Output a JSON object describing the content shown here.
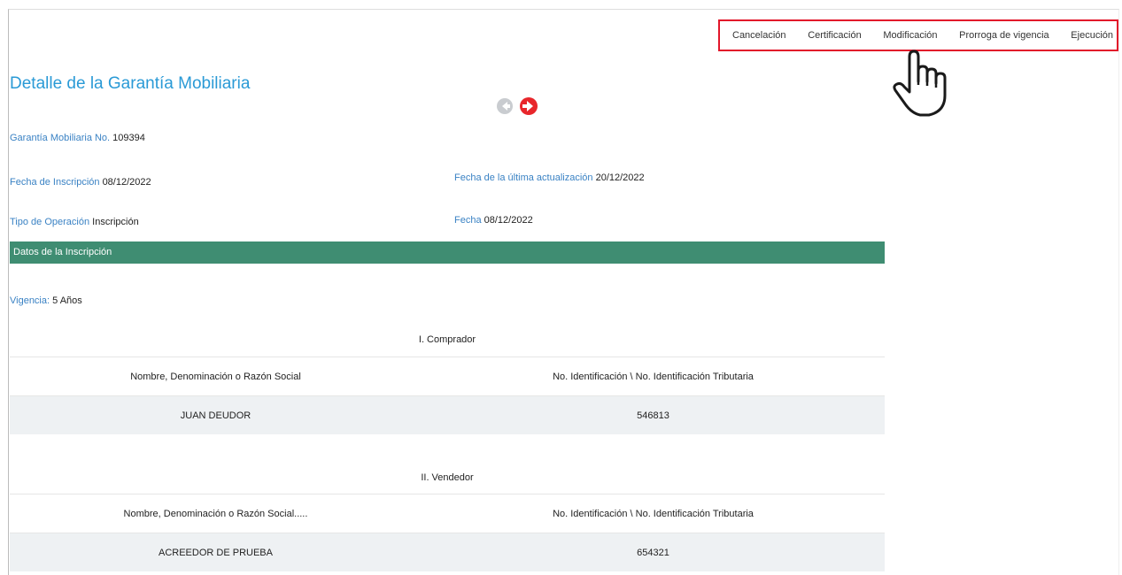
{
  "nav": {
    "items": [
      "Cancelación",
      "Certificación",
      "Modificación",
      "Prorroga de vigencia",
      "Ejecución"
    ]
  },
  "page": {
    "title": "Detalle de la Garantía Mobiliaria"
  },
  "details": {
    "garantia_label": "Garantía Mobiliaria No.",
    "garantia_value": "109394",
    "fecha_inscripcion_label": "Fecha de Inscripción",
    "fecha_inscripcion_value": "08/12/2022",
    "fecha_actualizacion_label": "Fecha de la última actualización",
    "fecha_actualizacion_value": "20/12/2022",
    "tipo_operacion_label": "Tipo de Operación",
    "tipo_operacion_value": "Inscripción",
    "fecha_label": "Fecha",
    "fecha_value": "08/12/2022"
  },
  "section": {
    "title": "Datos de la Inscripción",
    "vigencia_label": "Vigencia:",
    "vigencia_value": "5 Años"
  },
  "comprador": {
    "title": "I. Comprador",
    "headers": [
      "Nombre, Denominación o Razón Social",
      "No. Identificación \\ No. Identificación Tributaria"
    ],
    "rows": [
      [
        "JUAN DEUDOR",
        "546813"
      ]
    ]
  },
  "vendedor": {
    "title": "II. Vendedor",
    "headers": [
      "Nombre, Denominación o Razón Social.....",
      "No. Identificación \\ No. Identificación Tributaria"
    ],
    "rows": [
      [
        "ACREEDOR DE PRUEBA",
        "654321"
      ]
    ]
  },
  "colors": {
    "accent": "#2a9ad6",
    "label": "#3a82c4",
    "section_bar": "#3f8d72",
    "highlight": "#e2162a",
    "next_arrow": "#e8262b"
  },
  "icons": {
    "prev": "arrow-left-circle-icon",
    "next": "arrow-right-circle-icon",
    "pointer": "hand-pointer-icon"
  }
}
